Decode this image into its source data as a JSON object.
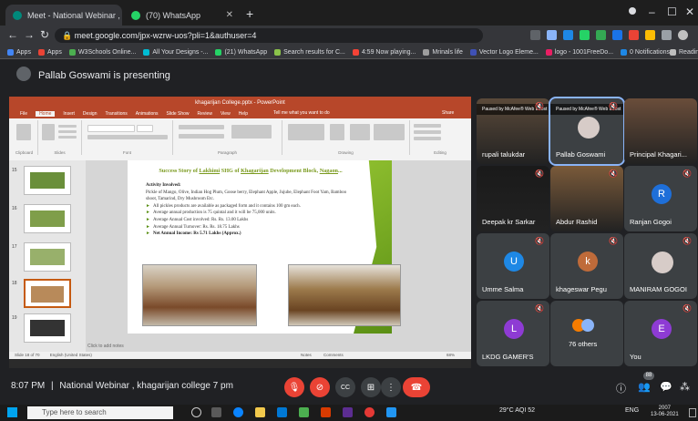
{
  "browser": {
    "tabs": [
      {
        "label": "Meet - National Webinar , k",
        "fav_color": "#00897b"
      },
      {
        "label": "(70) WhatsApp",
        "fav_color": "#25d366"
      }
    ],
    "new_tab": "+",
    "window_controls": [
      "–",
      "☐",
      "✕"
    ],
    "url": "meet.google.com/jpx-wzrw-uos?pli=1&authuser=4",
    "bookmarks": [
      {
        "label": "Apps",
        "color": "#4285f4"
      },
      {
        "label": "Apps",
        "color": "#ea4335"
      },
      {
        "label": "W3Schools Online...",
        "color": "#4caf50"
      },
      {
        "label": "All Your Designs -...",
        "color": "#00bcd4"
      },
      {
        "label": "(21) WhatsApp",
        "color": "#25d366"
      },
      {
        "label": "Search results for C...",
        "color": "#8bc34a"
      },
      {
        "label": "4:59 Now playing...",
        "color": "#f44336"
      },
      {
        "label": "Mrinals life",
        "color": "#9e9e9e"
      },
      {
        "label": "Vector Logo Eleme...",
        "color": "#3f51b5"
      },
      {
        "label": "logo - 1001FreeDo...",
        "color": "#e91e63"
      },
      {
        "label": "0 Notifications",
        "color": "#1e88e5"
      },
      {
        "label": "Reading list",
        "color": "#bdbdbd"
      }
    ]
  },
  "meet": {
    "presenting_text": "Pallab Goswami is presenting",
    "time": "8:07 PM",
    "separator": "|",
    "meeting_title": "National Webinar , khagarijan college 7 pm",
    "others_count": "76 others"
  },
  "ppt": {
    "window_title": "khagarijan College.pptx - PowerPoint",
    "ribbon_tabs": [
      "File",
      "Home",
      "Insert",
      "Design",
      "Transitions",
      "Animations",
      "Slide Show",
      "Review",
      "View",
      "Help"
    ],
    "tell_me": "Tell me what you want to do",
    "share": "Share",
    "ribbon_groups": [
      "Clipboard",
      "Slides",
      "Font",
      "Paragraph",
      "Drawing",
      "Editing"
    ],
    "slide_numbers": [
      "15",
      "16",
      "17",
      "18",
      "19"
    ],
    "status_left": "Slide 18 of 70",
    "status_lang": "English (United States)",
    "notes": "Click to add notes",
    "notes_btn": "Notes",
    "comments_btn": "Comments",
    "zoom": "68%",
    "slide": {
      "title_parts": [
        "Success Story of ",
        "Lakhimi",
        " SHG of ",
        "Khagarijan",
        " Development Block, ",
        "Nagaon",
        "..."
      ],
      "activity_heading": "Activity Involved:",
      "activity_text": "Pickle of Mango, Olive, Indian Hog Plum, Goose berry, Elephant Apple, Jujube, Elephant Foot Yam, Bamboo shoot, Tamarind, Dry Mushroom Etc.",
      "bullets": [
        "All pickles products are available as packaged form and it contains 100 gm each.",
        "Average annual production is 75 quintal and it will be 75,000 units.",
        "Average Annual Cost involved: Rs. Rs. 13.00 Lakhs",
        "Average Annual Turnover: Rs. Rs. 18.75 Lakhs",
        "Net Annual Income: Rs 5.71 Lakhs (Approx.)"
      ]
    }
  },
  "participants": [
    {
      "name": "rupali talukdar",
      "kind": "video",
      "overlay": "Paused by McAfee® Web Boost"
    },
    {
      "name": "Pallab Goswami",
      "kind": "photo",
      "overlay": "Paused by McAfee® Web Boost"
    },
    {
      "name": "Principal Khagari...",
      "kind": "video"
    },
    {
      "name": "Deepak kr Sarkar",
      "kind": "video"
    },
    {
      "name": "Abdur Rashid",
      "kind": "video"
    },
    {
      "name": "Ranjan Gogoi",
      "kind": "avatar",
      "initial": "R",
      "color": "#1e6fd9"
    },
    {
      "name": "Umme Salma",
      "kind": "avatar",
      "initial": "U",
      "color": "#1e88e5"
    },
    {
      "name": "khageswar Pegu",
      "kind": "avatar",
      "initial": "k",
      "color": "#bf6b3a"
    },
    {
      "name": "MANIRAM GOGOI",
      "kind": "photo"
    },
    {
      "name": "LKDG GAMER'S",
      "kind": "avatar",
      "initial": "L",
      "color": "#8e3bd4"
    },
    {
      "name": "76 others",
      "kind": "others"
    },
    {
      "name": "You",
      "kind": "avatar",
      "initial": "E",
      "color": "#8e3bd4"
    }
  ],
  "controls": {
    "mic": "mic-off",
    "cam": "cam-off",
    "cc": "CC",
    "present": "present",
    "more": "⋮",
    "hangup": "hang-up",
    "people_count": "88"
  },
  "taskbar": {
    "search_placeholder": "Type here to search",
    "weather": "29°C AQI 52",
    "lang": "ENG",
    "time": "2007",
    "date": "13-06-2021"
  }
}
